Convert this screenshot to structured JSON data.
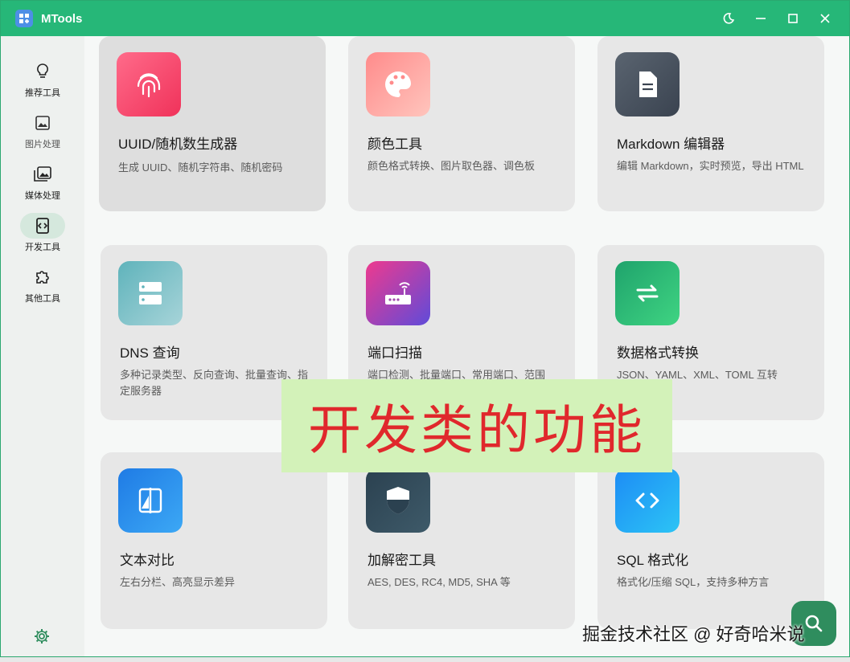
{
  "app": {
    "title": "MTools"
  },
  "sidebar": {
    "items": [
      {
        "label": "推荐工具",
        "icon": "lightbulb-icon",
        "active": false
      },
      {
        "label": "图片处理",
        "icon": "image-icon",
        "active": false
      },
      {
        "label": "媒体处理",
        "icon": "media-icon",
        "active": false
      },
      {
        "label": "开发工具",
        "icon": "code-icon",
        "active": true
      },
      {
        "label": "其他工具",
        "icon": "puzzle-icon",
        "active": false
      }
    ]
  },
  "cards": [
    {
      "title": "UUID/随机数生成器",
      "desc": "生成 UUID、随机字符串、随机密码",
      "icon": "fingerprint-icon"
    },
    {
      "title": "颜色工具",
      "desc": "颜色格式转换、图片取色器、调色板",
      "icon": "palette-icon"
    },
    {
      "title": "Markdown 编辑器",
      "desc": "编辑 Markdown，实时预览，导出 HTML",
      "icon": "document-icon"
    },
    {
      "title": "DNS 查询",
      "desc": "多种记录类型、反向查询、批量查询、指定服务器",
      "icon": "server-icon"
    },
    {
      "title": "端口扫描",
      "desc": "端口检测、批量端口、常用端口、范围",
      "icon": "router-icon"
    },
    {
      "title": "数据格式转换",
      "desc": "JSON、YAML、XML、TOML 互转",
      "icon": "swap-icon"
    },
    {
      "title": "文本对比",
      "desc": "左右分栏、高亮显示差异",
      "icon": "compare-icon"
    },
    {
      "title": "加解密工具",
      "desc": "AES, DES, RC4, MD5, SHA 等",
      "icon": "shield-icon"
    },
    {
      "title": "SQL 格式化",
      "desc": "格式化/压缩 SQL，支持多种方言",
      "icon": "code-brackets-icon"
    }
  ],
  "overlay": {
    "text": "开发类的功能"
  },
  "watermark": {
    "text": "掘金技术社区 @ 好奇哈米说"
  },
  "colors": {
    "titlebar": "#26b778",
    "accent": "#2f8d5e",
    "overlay_text": "#e0282c"
  }
}
